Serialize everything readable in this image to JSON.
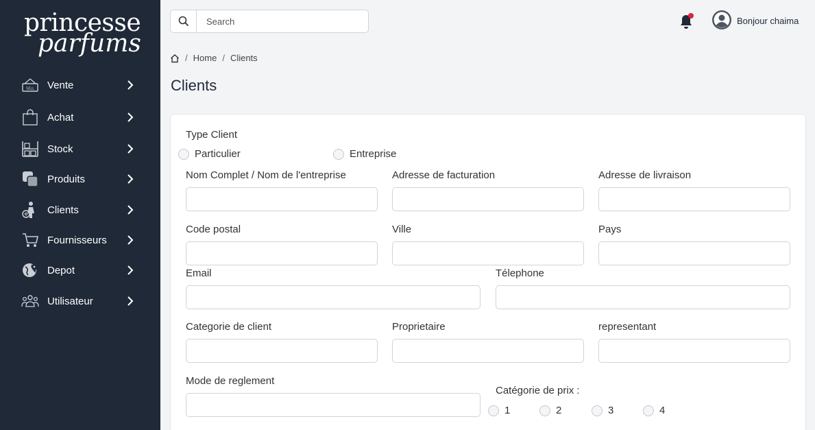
{
  "brand": {
    "line1": "princesse",
    "line2": "parfums"
  },
  "sidebar": {
    "items": [
      {
        "label": "Vente",
        "icon": "sell-sign-icon"
      },
      {
        "label": "Achat",
        "icon": "shopping-bag-icon"
      },
      {
        "label": "Stock",
        "icon": "warehouse-shelves-icon"
      },
      {
        "label": "Produits",
        "icon": "copy-squares-icon"
      },
      {
        "label": "Clients",
        "icon": "person-with-cart-icon"
      },
      {
        "label": "Fournisseurs",
        "icon": "cart-icon"
      },
      {
        "label": "Depot",
        "icon": "globe-pin-icon"
      },
      {
        "label": "Utilisateur",
        "icon": "users-group-icon"
      }
    ]
  },
  "topbar": {
    "search_placeholder": "Search",
    "greeting": "Bonjour chaima"
  },
  "breadcrumb": {
    "home": "Home",
    "current": "Clients"
  },
  "page": {
    "title": "Clients"
  },
  "form": {
    "type_label": "Type Client",
    "type_options": [
      "Particulier",
      "Entreprise"
    ],
    "fields": {
      "nom": "Nom Complet / Nom de l'entreprise",
      "adresse_facturation": "Adresse de facturation",
      "adresse_livraison": "Adresse de livraison",
      "code_postal": "Code postal",
      "ville": "Ville",
      "pays": "Pays",
      "email": "Email",
      "telephone": "Télephone",
      "categorie_client": "Categorie de client",
      "proprietaire": "Proprietaire",
      "representant": "representant",
      "mode_reglement": "Mode de reglement"
    },
    "prix_label": "Catégorie de prix :",
    "prix_options": [
      "1",
      "2",
      "3",
      "4"
    ]
  },
  "colors": {
    "sidebar_bg": "#1f2937",
    "page_bg": "#f3f4f6",
    "notification_dot": "#e0223a"
  }
}
